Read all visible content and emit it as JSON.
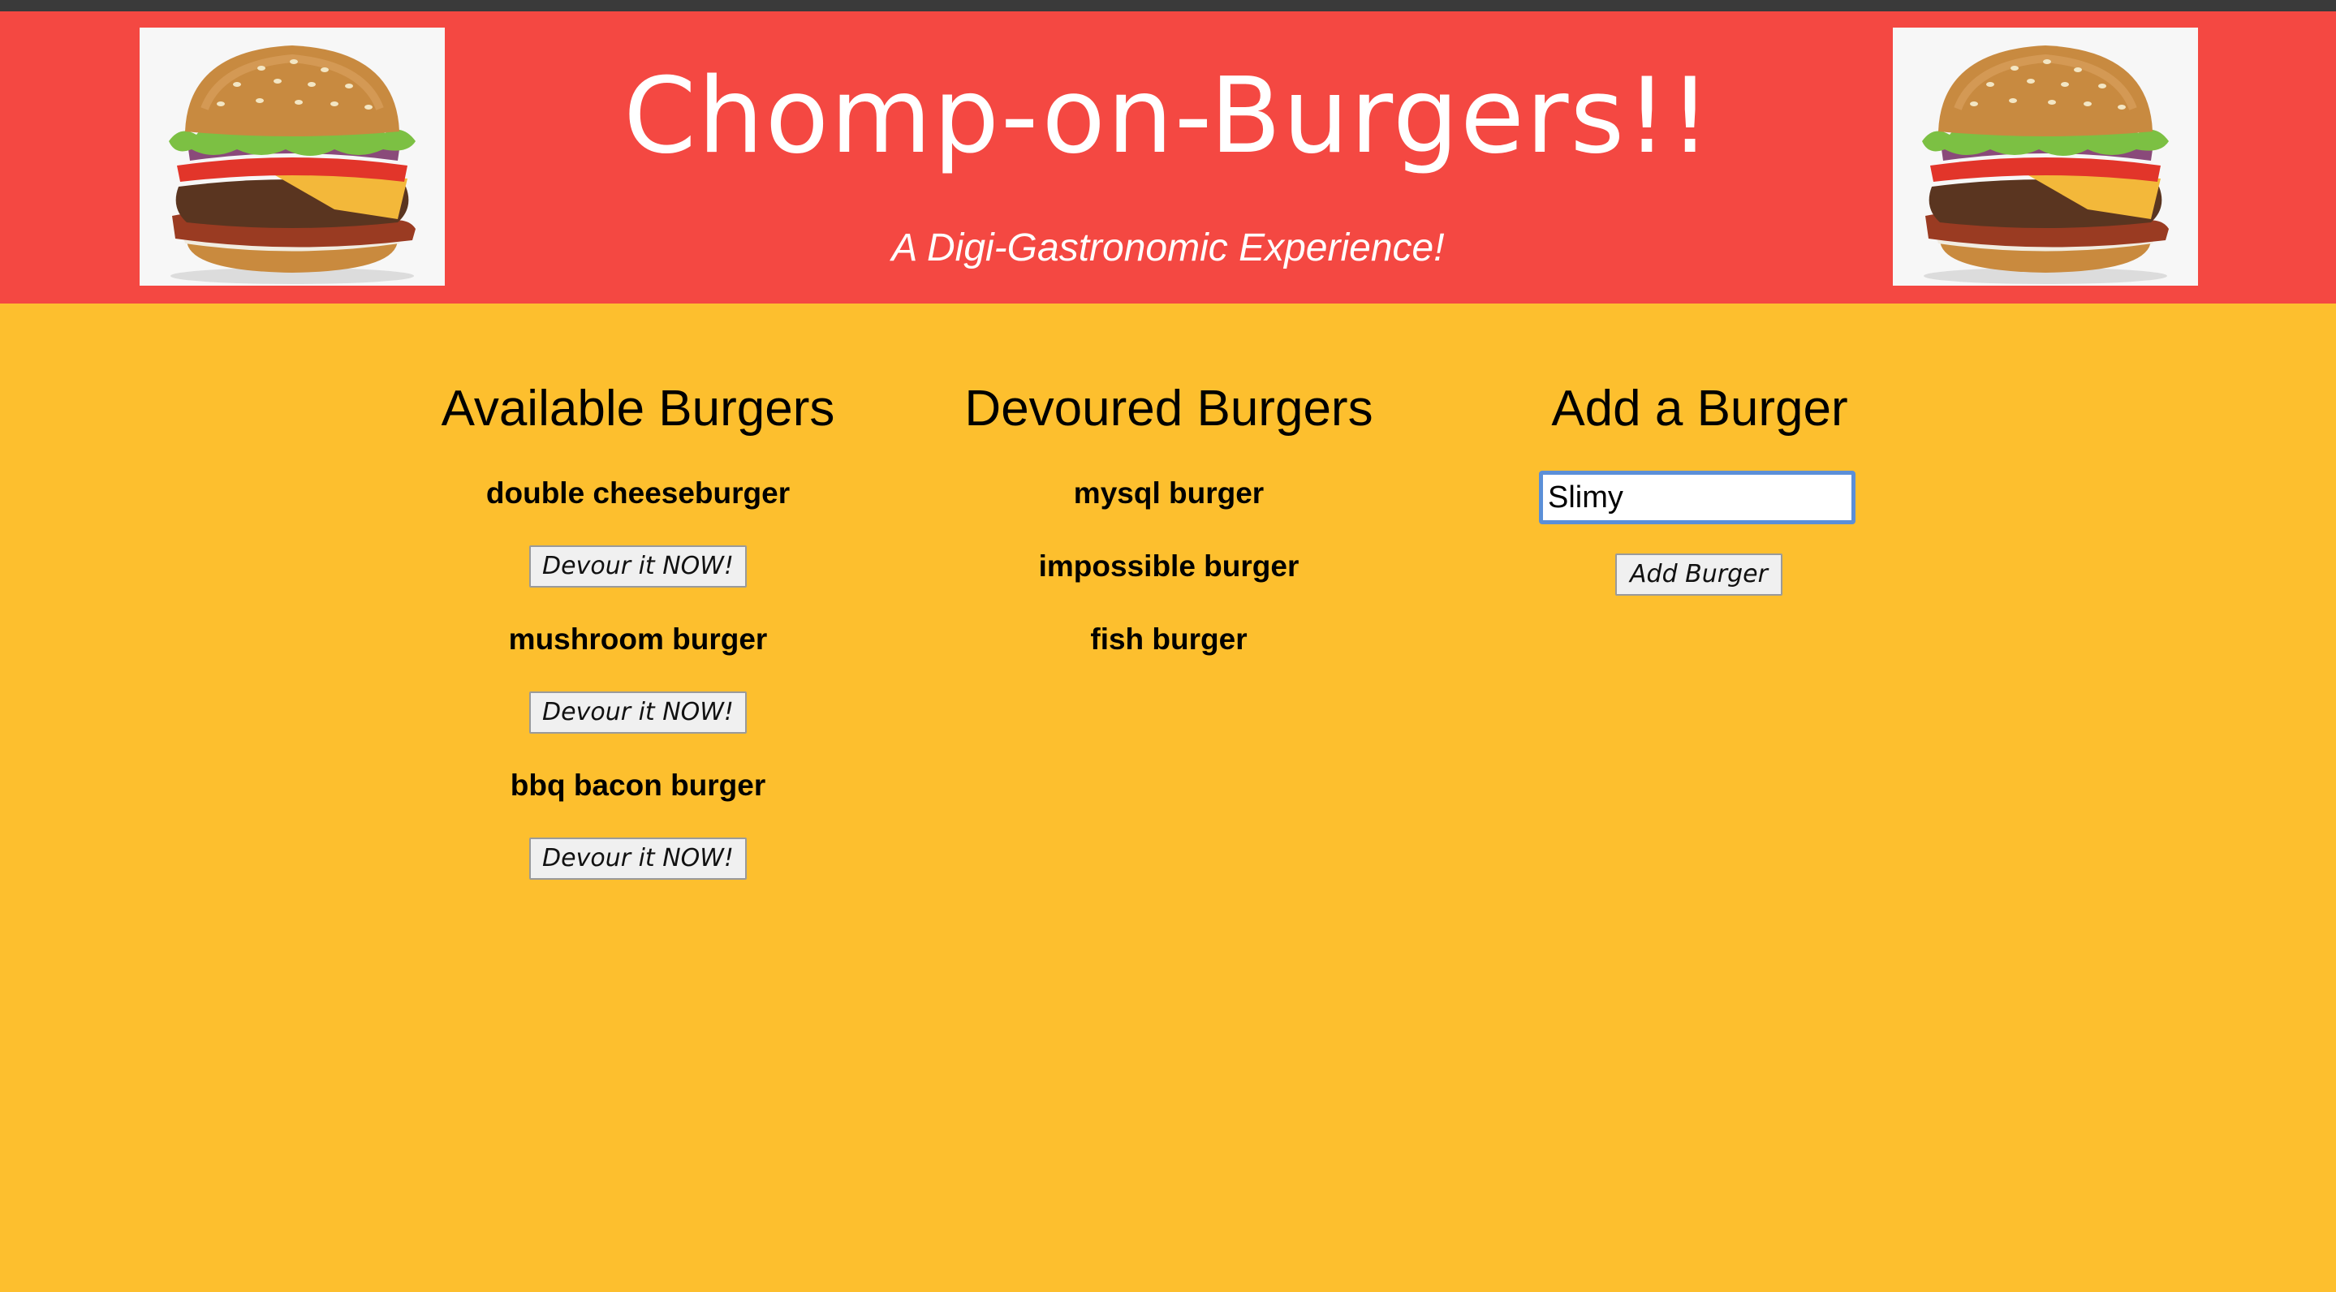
{
  "header": {
    "title": "Chomp-on-Burgers!!",
    "subtitle": "A Digi-Gastronomic Experience!"
  },
  "available": {
    "heading": "Available Burgers",
    "items": [
      {
        "name": "double cheeseburger",
        "button": "Devour it NOW!"
      },
      {
        "name": "mushroom burger",
        "button": "Devour it NOW!"
      },
      {
        "name": "bbq bacon burger",
        "button": "Devour it NOW!"
      }
    ]
  },
  "devoured": {
    "heading": "Devoured Burgers",
    "items": [
      "mysql burger",
      "impossible burger",
      "fish burger"
    ]
  },
  "add": {
    "heading": "Add a Burger",
    "input_value": "Slimy",
    "button": "Add Burger"
  },
  "colors": {
    "header_red": "#f44842",
    "body_yellow": "#fdbf2e",
    "input_focus_blue": "#5b8fd8"
  },
  "icons": {
    "header_left_image": "burger-photo",
    "header_right_image": "burger-photo"
  }
}
